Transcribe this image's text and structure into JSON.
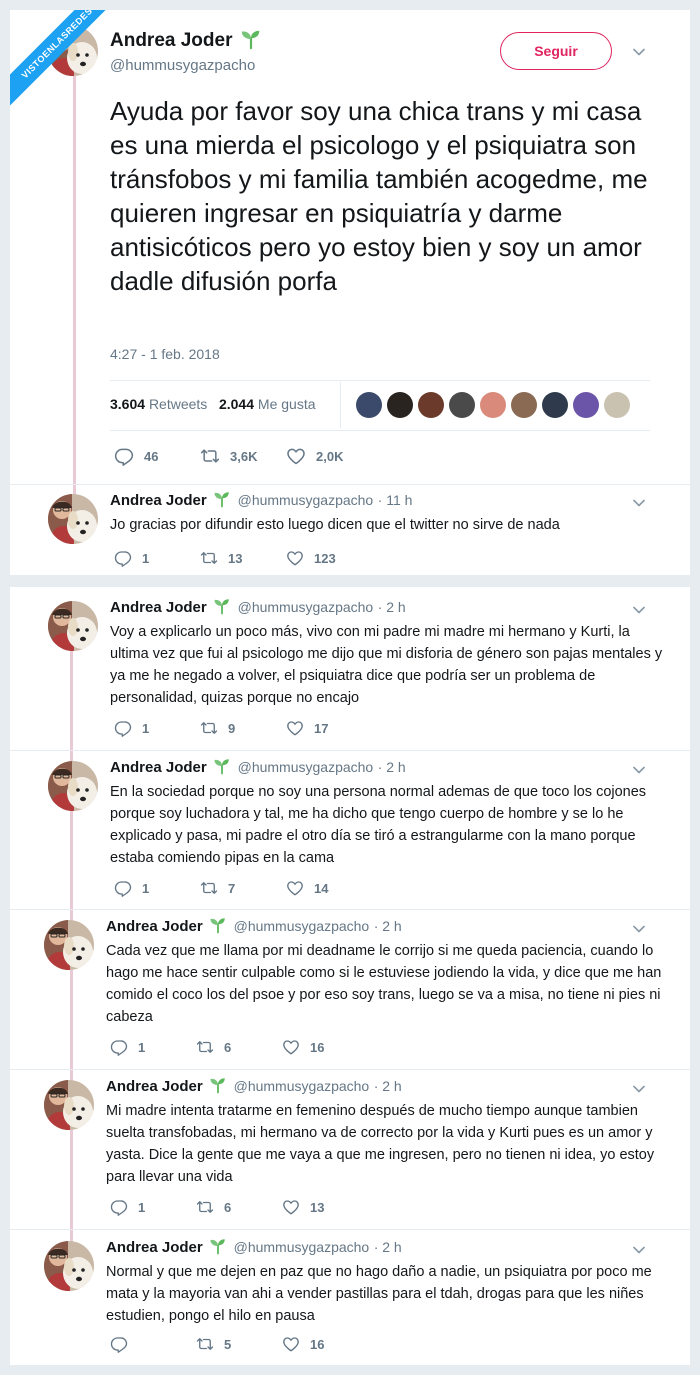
{
  "watermark": "VISTOENLASREDES",
  "author": {
    "name": "Andrea Joder",
    "handle": "@hummusygazpacho"
  },
  "main_tweet": {
    "follow_label": "Seguir",
    "text": "Ayuda por favor soy una chica trans y mi casa es una mierda el psicologo y el psiquiatra son tránsfobos y mi familia también acogedme, me quieren ingresar en psiquiatría y darme antisicóticos pero yo estoy bien y soy un amor dadle difusión porfa",
    "timestamp": "4:27 - 1 feb. 2018",
    "retweets_count": "3.604",
    "retweets_label": "Retweets",
    "likes_count": "2.044",
    "likes_label": "Me gusta",
    "replies": "46",
    "retweets_short": "3,6K",
    "likes_short": "2,0K"
  },
  "replies": [
    {
      "time": "· 11 h",
      "text": "Jo gracias por difundir esto luego dicen que el twitter no sirve de nada",
      "replies": "1",
      "retweets": "13",
      "likes": "123"
    },
    {
      "time": "· 2 h",
      "text": "Voy a explicarlo un poco más, vivo con mi padre mi madre mi hermano y Kurti, la ultima vez que fui al psicologo me dijo que mi disforia de género son pajas mentales y ya me he negado a volver, el psiquiatra dice que podría ser un problema de personalidad, quizas porque no encajo",
      "replies": "1",
      "retweets": "9",
      "likes": "17"
    },
    {
      "time": "· 2 h",
      "text": "En la sociedad porque no soy una persona normal ademas de que toco los cojones porque soy luchadora y tal, me ha dicho que tengo cuerpo de hombre y se lo he explicado y pasa, mi padre el otro día se tiró a estrangularme con la mano porque estaba comiendo pipas en la cama",
      "replies": "1",
      "retweets": "7",
      "likes": "14"
    },
    {
      "time": "· 2 h",
      "text": "Cada vez que me llama por mi deadname le corrijo si me queda paciencia, cuando lo hago me hace sentir culpable como si le estuviese jodiendo la vida, y dice que me han comido el coco los del psoe y por eso soy trans, luego se va a misa, no tiene ni pies ni cabeza",
      "replies": "1",
      "retweets": "6",
      "likes": "16"
    },
    {
      "time": "· 2 h",
      "text": "Mi madre intenta tratarme en femenino después de mucho tiempo aunque tambien suelta transfobadas, mi hermano va de correcto por la vida y Kurti pues es un amor y yasta. Dice la gente que me vaya a que me ingresen, pero no tienen ni idea, yo estoy para llevar una vida",
      "replies": "1",
      "retweets": "6",
      "likes": "13"
    },
    {
      "time": "· 2 h",
      "text": "Normal y que me dejen en paz que no hago daño a nadie, un psiquiatra por poco me mata y la mayoria van ahi a vender pastillas para el tdah, drogas para que les niñes estudien, pongo el hilo en pausa",
      "replies": "",
      "retweets": "5",
      "likes": "16"
    }
  ],
  "colors": {
    "accent": "#e0245e",
    "muted": "#657786",
    "thread_line": "#e8c9d4",
    "background": "#e6ecf0"
  },
  "icons": [
    "reply-icon",
    "retweet-icon",
    "heart-icon",
    "chevron-down-icon",
    "sprout-icon"
  ]
}
